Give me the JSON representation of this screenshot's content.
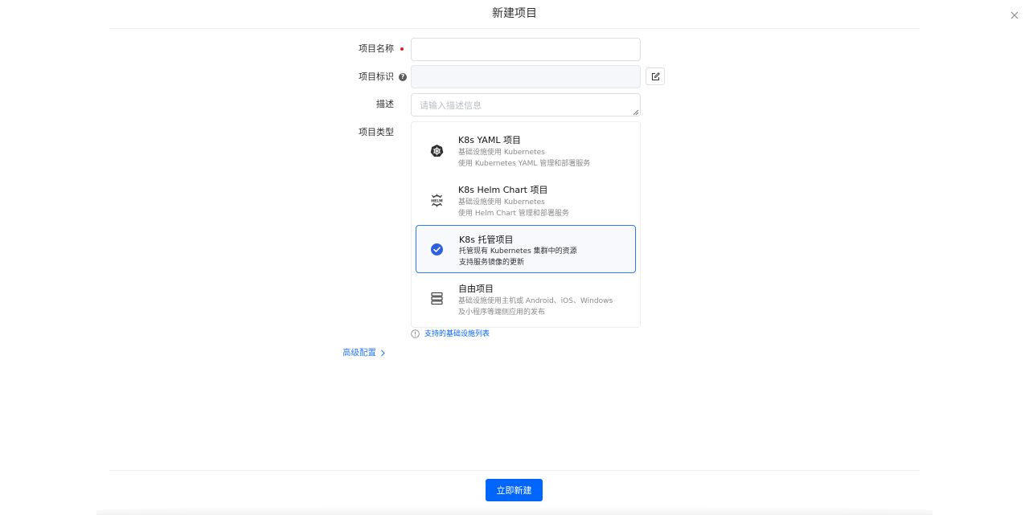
{
  "dialog": {
    "title": "新建项目",
    "submit_label": "立即新建"
  },
  "form": {
    "name": {
      "label": "项目名称",
      "value": ""
    },
    "key": {
      "label": "项目标识",
      "value": ""
    },
    "description": {
      "label": "描述",
      "placeholder": "请输入描述信息",
      "value": ""
    },
    "type": {
      "label": "项目类型",
      "selected": "K8s 托管项目",
      "options": [
        {
          "title": "K8s YAML 项目",
          "desc1": "基础设施使用 Kubernetes",
          "desc2": "使用 Kubernetes YAML 管理和部署服务",
          "icon": "kubernetes-icon"
        },
        {
          "title": "K8s Helm Chart 项目",
          "desc1": "基础设施使用 Kubernetes",
          "desc2": "使用 Helm Chart 管理和部署服务",
          "icon": "helm-icon"
        },
        {
          "title": "K8s 托管项目",
          "desc1": "托管现有 Kubernetes 集群中的资源",
          "desc2": "支持服务镜像的更新",
          "icon": "check-circle-icon"
        },
        {
          "title": "自由项目",
          "desc1": "基础设施使用主机或 Android、iOS、Windows",
          "desc2": "及小程序等端侧应用的发布",
          "icon": "server-stack-icon"
        }
      ]
    },
    "infra_link": "支持的基础设施列表",
    "advanced_label": "高级配置"
  },
  "colors": {
    "primary": "#0066ff",
    "selected_border": "#2d7bf4",
    "required": "#e02020"
  }
}
